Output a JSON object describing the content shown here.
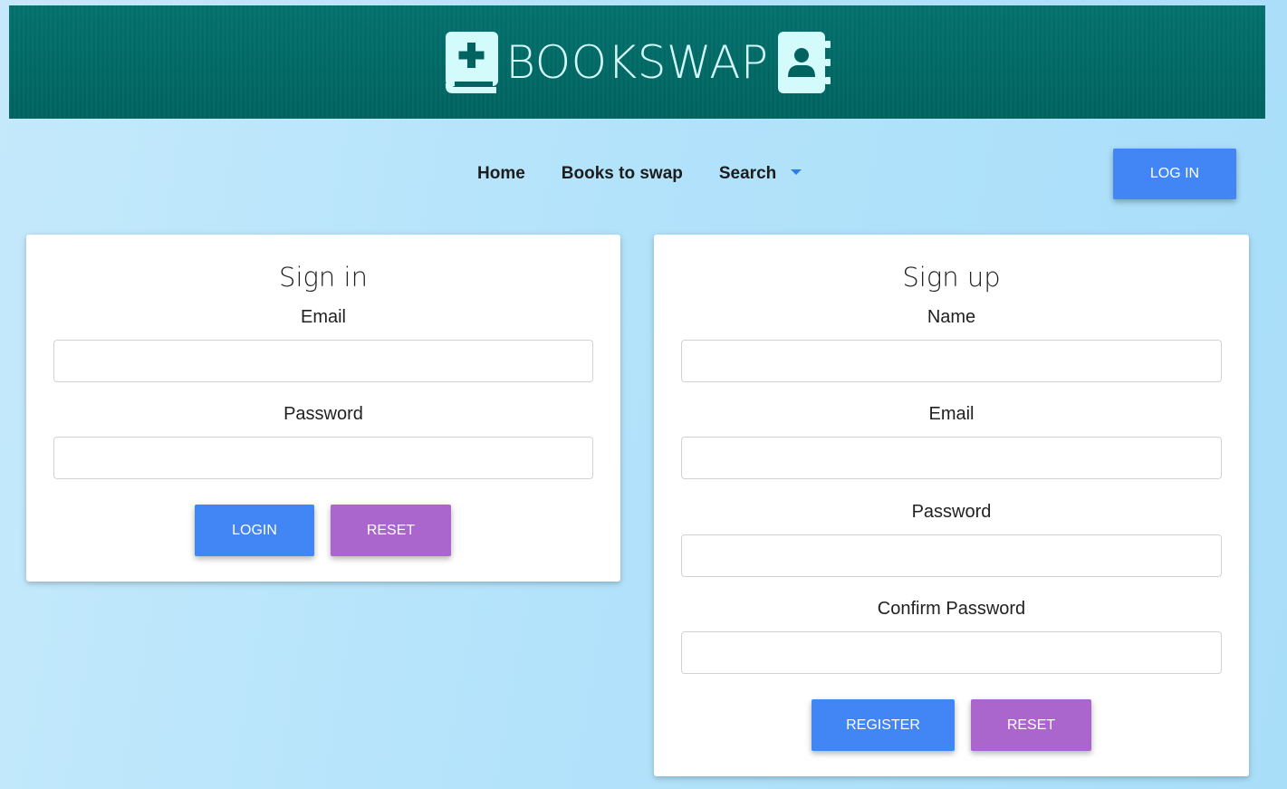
{
  "header": {
    "brand": "BOOKSWAP",
    "brand_color": "#d4fbfb",
    "banner_color": "#00635f",
    "left_icon": "book-medical-icon",
    "right_icon": "address-book-icon"
  },
  "nav": {
    "items": [
      {
        "label": "Home"
      },
      {
        "label": "Books to swap"
      },
      {
        "label": "Search",
        "has_dropdown": true
      }
    ],
    "login_button": "LOG IN"
  },
  "signin": {
    "title": "Sign in",
    "email_label": "Email",
    "email_value": "",
    "password_label": "Password",
    "password_value": "",
    "login_button": "LOGIN",
    "reset_button": "RESET"
  },
  "signup": {
    "title": "Sign up",
    "name_label": "Name",
    "name_value": "",
    "email_label": "Email",
    "email_value": "",
    "password_label": "Password",
    "password_value": "",
    "confirm_label": "Confirm Password",
    "confirm_value": "",
    "register_button": "REGISTER",
    "reset_button": "RESET"
  },
  "colors": {
    "primary": "#4285f4",
    "secondary": "#aa66cc",
    "caret": "#2b7de9"
  }
}
